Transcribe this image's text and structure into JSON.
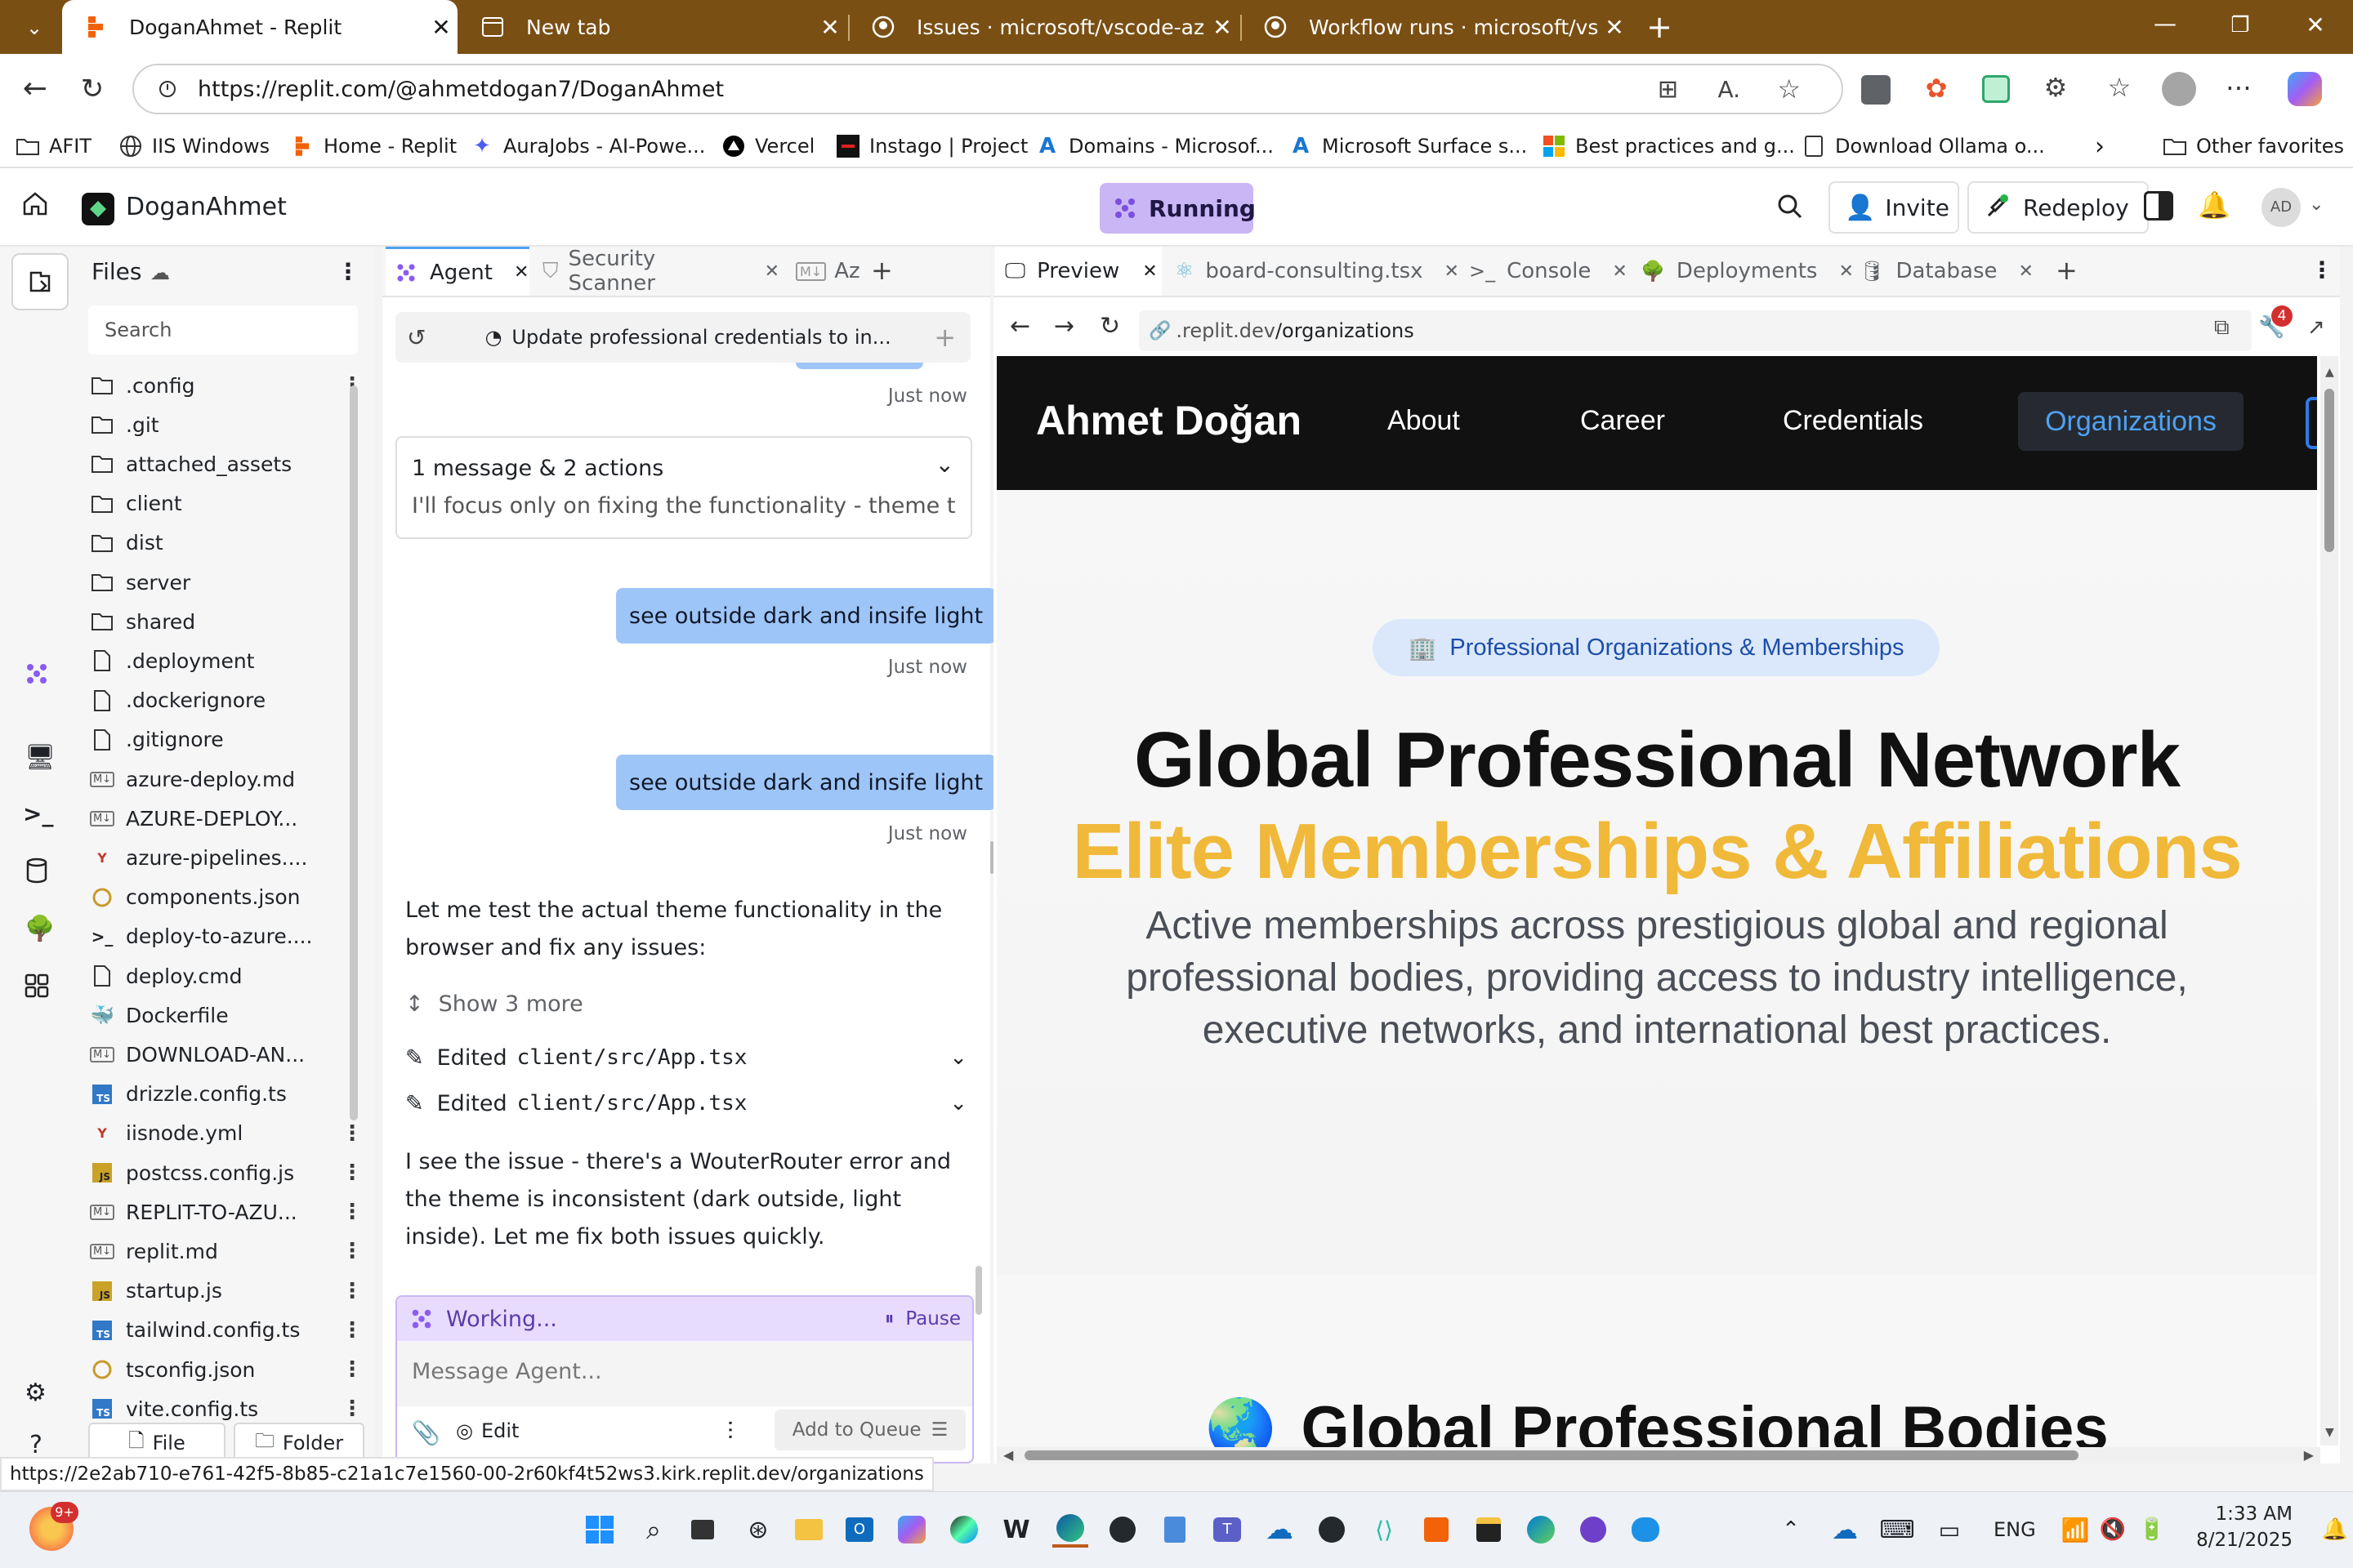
{
  "browser": {
    "tabs": [
      {
        "title": "DoganAhmet - Replit",
        "active": true
      },
      {
        "title": "New tab"
      },
      {
        "title": "Issues · microsoft/vscode-azureap"
      },
      {
        "title": "Workflow runs · microsoft/vscode"
      }
    ],
    "url": "https://replit.com/@ahmetdogan7/DoganAhmet",
    "bookmarks": [
      "AFIT",
      "IIS Windows",
      "Home - Replit",
      "AuraJobs - AI-Powe...",
      "Vercel",
      "Instago | Project",
      "Domains - Microsof...",
      "Microsoft Surface s...",
      "Best practices and g...",
      "Download Ollama o..."
    ],
    "other_favorites": "Other favorites"
  },
  "replit": {
    "project": "DoganAhmet",
    "status": "Running",
    "invite": "Invite",
    "redeploy": "Redeploy",
    "avatar": "AD"
  },
  "files": {
    "title": "Files",
    "search_placeholder": "Search",
    "items": [
      {
        "name": ".config",
        "type": "folder"
      },
      {
        "name": ".git",
        "type": "folder"
      },
      {
        "name": "attached_assets",
        "type": "folder"
      },
      {
        "name": "client",
        "type": "folder"
      },
      {
        "name": "dist",
        "type": "folder"
      },
      {
        "name": "server",
        "type": "folder"
      },
      {
        "name": "shared",
        "type": "folder"
      },
      {
        "name": ".deployment",
        "type": "file"
      },
      {
        "name": ".dockerignore",
        "type": "file"
      },
      {
        "name": ".gitignore",
        "type": "file"
      },
      {
        "name": "azure-deploy.md",
        "type": "md"
      },
      {
        "name": "AZURE-DEPLOY...",
        "type": "md"
      },
      {
        "name": "azure-pipelines....",
        "type": "yml"
      },
      {
        "name": "components.json",
        "type": "json"
      },
      {
        "name": "deploy-to-azure....",
        "type": "shell"
      },
      {
        "name": "deploy.cmd",
        "type": "file"
      },
      {
        "name": "Dockerfile",
        "type": "docker"
      },
      {
        "name": "DOWNLOAD-AN...",
        "type": "md"
      },
      {
        "name": "drizzle.config.ts",
        "type": "ts"
      },
      {
        "name": "iisnode.yml",
        "type": "yml"
      },
      {
        "name": "postcss.config.js",
        "type": "js"
      },
      {
        "name": "REPLIT-TO-AZU...",
        "type": "md"
      },
      {
        "name": "replit.md",
        "type": "md"
      },
      {
        "name": "startup.js",
        "type": "js"
      },
      {
        "name": "tailwind.config.ts",
        "type": "ts"
      },
      {
        "name": "tsconfig.json",
        "type": "json"
      },
      {
        "name": "vite.config.ts",
        "type": "ts"
      }
    ],
    "new_file": "File",
    "new_folder": "Folder"
  },
  "agent": {
    "tabs": [
      "Agent",
      "Security Scanner",
      "Az"
    ],
    "thread_title": "Update professional credentials to in...",
    "ts_top": "Just now",
    "summary_title": "1 message & 2 actions",
    "summary_text": "I'll focus only on fixing the functionality - theme tog...",
    "user_msg_1": "see outside dark and insife light",
    "ts_1": "Just now",
    "user_msg_2": "see outside dark and insife light",
    "ts_2": "Just now",
    "reply_1": "Let me test the actual theme functionality in the browser and fix any issues:",
    "show_more": "Show 3 more",
    "edit_prefix": "Edited",
    "edit_1": "client/src/App.tsx",
    "edit_2": "client/src/App.tsx",
    "reply_2": "I see the issue - there's a WouterRouter error and the theme is inconsistent (dark outside, light inside). Let me fix both issues quickly.",
    "working": "Working...",
    "pause": "Pause",
    "input_placeholder": "Message Agent...",
    "edit_btn": "Edit",
    "queue_btn": "Add to Queue"
  },
  "preview": {
    "tabs": [
      "Preview",
      "board-consulting.tsx",
      "Console",
      "Deployments",
      "Database"
    ],
    "url_prefix": ".replit.dev",
    "url_path": "/organizations",
    "badge_count": "4",
    "site": {
      "brand": "Ahmet Doğan",
      "nav": [
        "About",
        "Career",
        "Credentials",
        "Organizations"
      ],
      "pill": "Professional Organizations & Memberships",
      "heading_1": "Global Professional Network",
      "heading_2": "Elite Memberships & Affiliations",
      "lead": "Active memberships across prestigious global and regional professional bodies, providing access to industry intelligence, executive networks, and international best practices.",
      "section_emoji": "🌏",
      "section_title": "Global Professional Bodies"
    }
  },
  "status_url": "https://2e2ab710-e761-42f5-8b85-c21a1c7e1560-00-2r60kf4t52ws3.kirk.replit.dev/organizations",
  "taskbar": {
    "notif": "9+",
    "lang": "ENG",
    "time": "1:33 AM",
    "date": "8/21/2025"
  },
  "colors": {
    "accent": "#f0b93a",
    "running_bg": "#c9b6f5",
    "bubble": "#9ec5f8",
    "nav_dark": "#111111",
    "link_blue": "#4ea1f3"
  }
}
